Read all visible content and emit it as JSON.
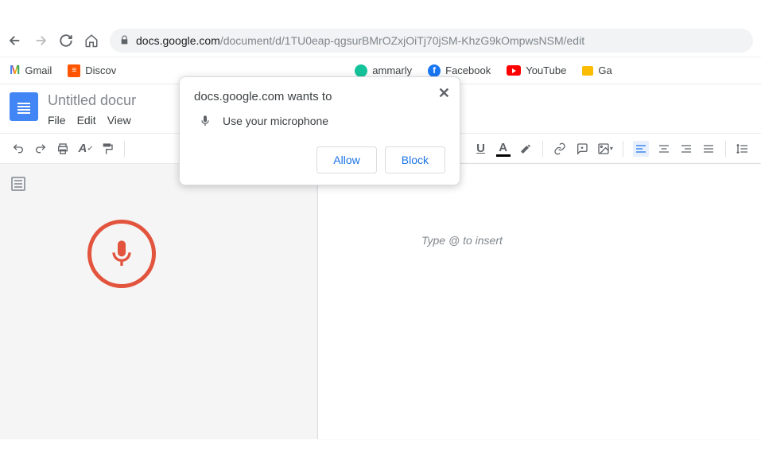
{
  "url": {
    "host": "docs.google.com",
    "path": "/document/d/1TU0eap-qgsurBMrOZxjOiTj70jSM-KhzG9kOmpwsNSM/edit"
  },
  "bookmarks": {
    "gmail": "Gmail",
    "discover": "Discov",
    "grammarly": "ammarly",
    "facebook": "Facebook",
    "youtube": "YouTube",
    "ga": "Ga"
  },
  "doc": {
    "title": "Untitled docur"
  },
  "menus": {
    "file": "File",
    "edit": "Edit",
    "view": "View"
  },
  "permission": {
    "title": "docs.google.com wants to",
    "line": "Use your microphone",
    "allow": "Allow",
    "block": "Block"
  },
  "editor": {
    "placeholder": "Type @ to insert"
  }
}
